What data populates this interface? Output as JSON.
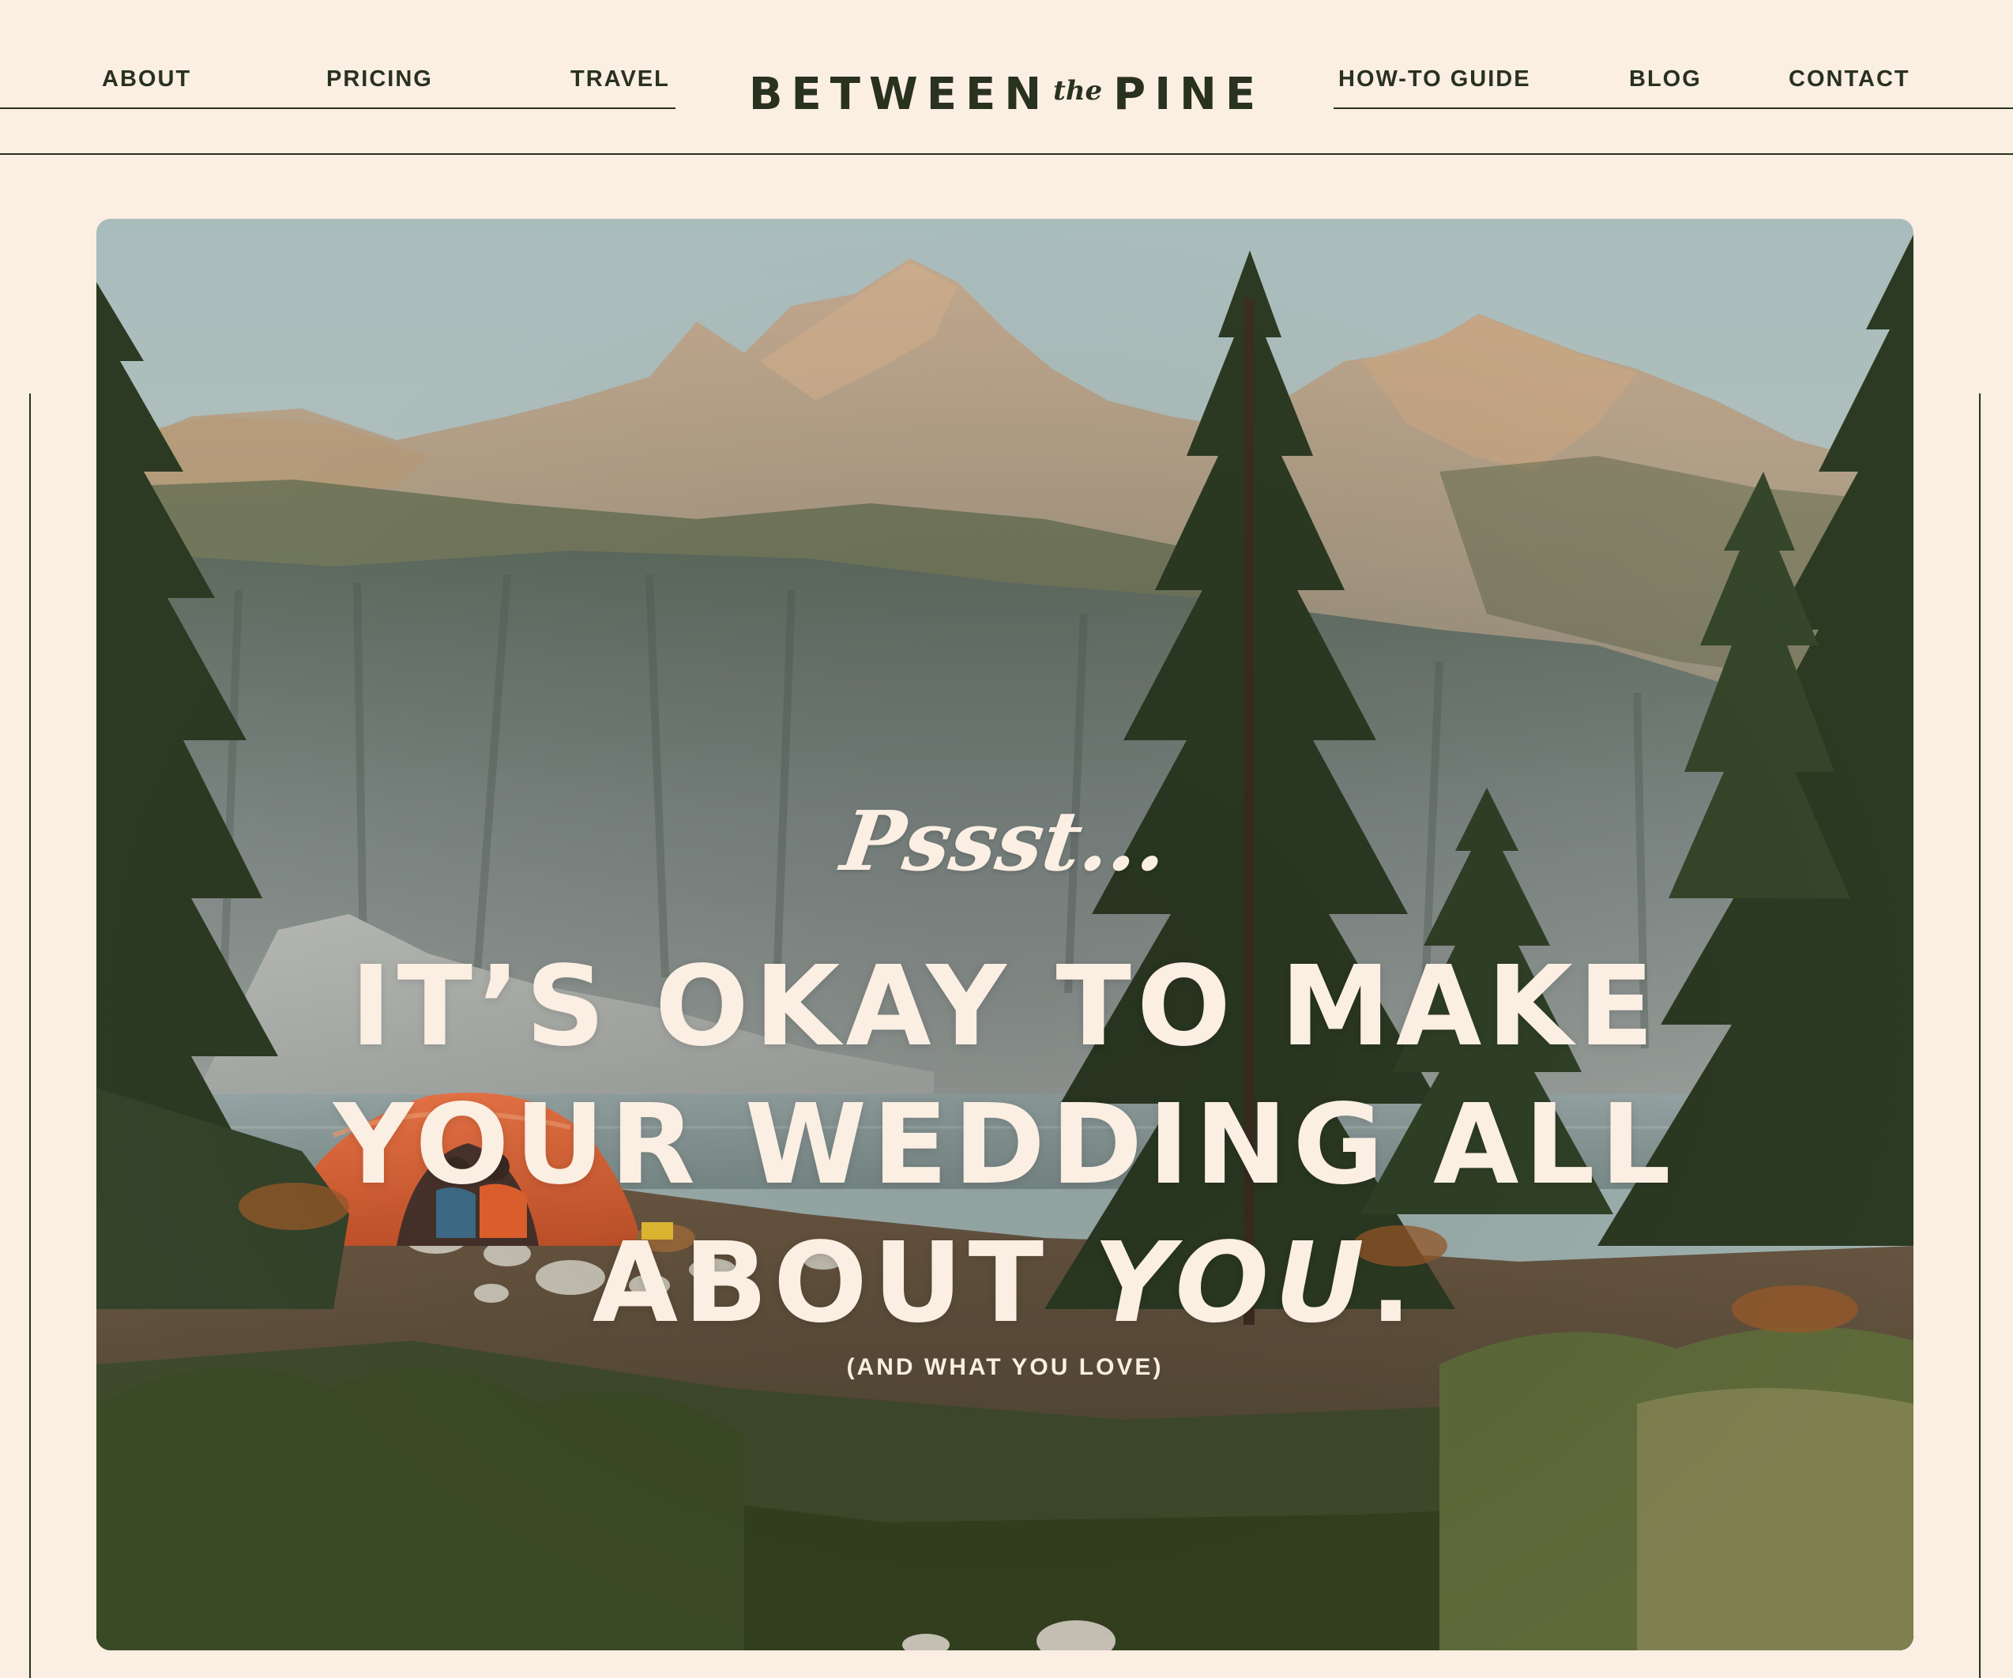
{
  "nav": {
    "left": [
      {
        "label": "ABOUT"
      },
      {
        "label": "PRICING"
      },
      {
        "label": "TRAVEL"
      }
    ],
    "right": [
      {
        "label": "HOW-TO GUIDE"
      },
      {
        "label": "BLOG"
      },
      {
        "label": "CONTACT"
      }
    ]
  },
  "logo": {
    "word1": "BETWEEN",
    "connector": "the",
    "word2": "PINE"
  },
  "hero": {
    "kicker": "Pssst...",
    "headline_line1": "IT’S OKAY TO MAKE",
    "headline_line2": "YOUR WEDDING ALL",
    "headline_line3_prefix": "ABOUT",
    "headline_line3_emphasis": "YOU",
    "headline_line3_suffix": ".",
    "subline": "(AND WHAT YOU LOVE)"
  },
  "colors": {
    "background": "#fbeee3",
    "ink": "#29311f",
    "hero_text": "#fbeee3",
    "tent": "#e0612f"
  },
  "icons": {
    "hero_image": "mountain-lake-camp-photo"
  }
}
